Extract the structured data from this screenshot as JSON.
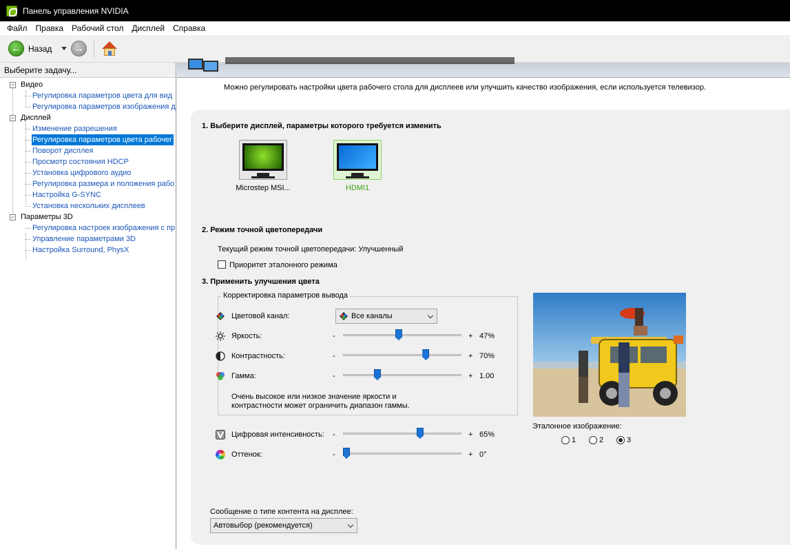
{
  "window": {
    "title": "Панель управления NVIDIA"
  },
  "menu": [
    "Файл",
    "Правка",
    "Рабочий стол",
    "Дисплей",
    "Справка"
  ],
  "toolbar": {
    "back_label": "Назад"
  },
  "sidebar": {
    "header": "Выберите задачу...",
    "categories": [
      {
        "label": "Видео",
        "items": [
          "Регулировка параметров цвета для вид",
          "Регулировка параметров изображения д"
        ]
      },
      {
        "label": "Дисплей",
        "items": [
          "Изменение разрешения",
          "Регулировка параметров цвета рабочег",
          "Поворот дисплея",
          "Просмотр состояния HDCP",
          "Установка цифрового аудио",
          "Регулировка размера и положения рабо",
          "Настройка G-SYNC",
          "Установка нескольких дисплеев"
        ]
      },
      {
        "label": "Параметры 3D",
        "items": [
          "Регулировка настроек изображения с пр",
          "Управление параметрами 3D",
          "Настройка Surround, PhysX"
        ]
      }
    ],
    "selected": "Регулировка параметров цвета рабочег"
  },
  "main": {
    "intro": "Можно регулировать настройки цвета рабочего стола для дисплеев или улучшить качество изображения, если используется телевизор.",
    "section1": {
      "title": "1. Выберите дисплей, параметры которого требуется изменить",
      "displays": [
        {
          "name": "Microstep MSI...",
          "selected": false
        },
        {
          "name": "HDMI1",
          "selected": true
        }
      ]
    },
    "section2": {
      "title": "2. Режим точной цветопередачи",
      "current_mode": "Текущий режим точной цветопередачи: Улучшенный",
      "checkbox_label": "Приоритет эталонного режима",
      "checkbox_checked": false
    },
    "section3": {
      "title": "3. Применить улучшения цвета",
      "group_label": "Корректировка параметров вывода",
      "channel_label": "Цветовой канал:",
      "channel_value": "Все каналы",
      "minus": "-",
      "plus": "+",
      "brightness": {
        "label": "Яркость:",
        "value": "47%",
        "level": 0.47
      },
      "contrast": {
        "label": "Контрастность:",
        "value": "70%",
        "level": 0.7
      },
      "gamma": {
        "label": "Гамма:",
        "value": "1.00",
        "level": 0.29
      },
      "note_line1": "Очень высокое или низкое значение яркости и",
      "note_line2": "контрастности может ограничить диапазон гаммы.",
      "vibrance": {
        "label": "Цифровая интенсивность:",
        "value": "65%",
        "level": 0.65
      },
      "hue": {
        "label": "Оттенок:",
        "value": "0°",
        "level": 0.0
      },
      "reference": {
        "label": "Эталонное изображение:",
        "options": [
          "1",
          "2",
          "3"
        ],
        "selected": "3"
      }
    },
    "content_type": {
      "label": "Сообщение о типе контента на дисплее:",
      "value": "Автовыбор (рекомендуется)"
    }
  },
  "colors": {
    "accent": "#0078d7",
    "nvidia_green": "#76b900",
    "slider_thumb": "#1e74d6",
    "link": "#1a56b8"
  }
}
